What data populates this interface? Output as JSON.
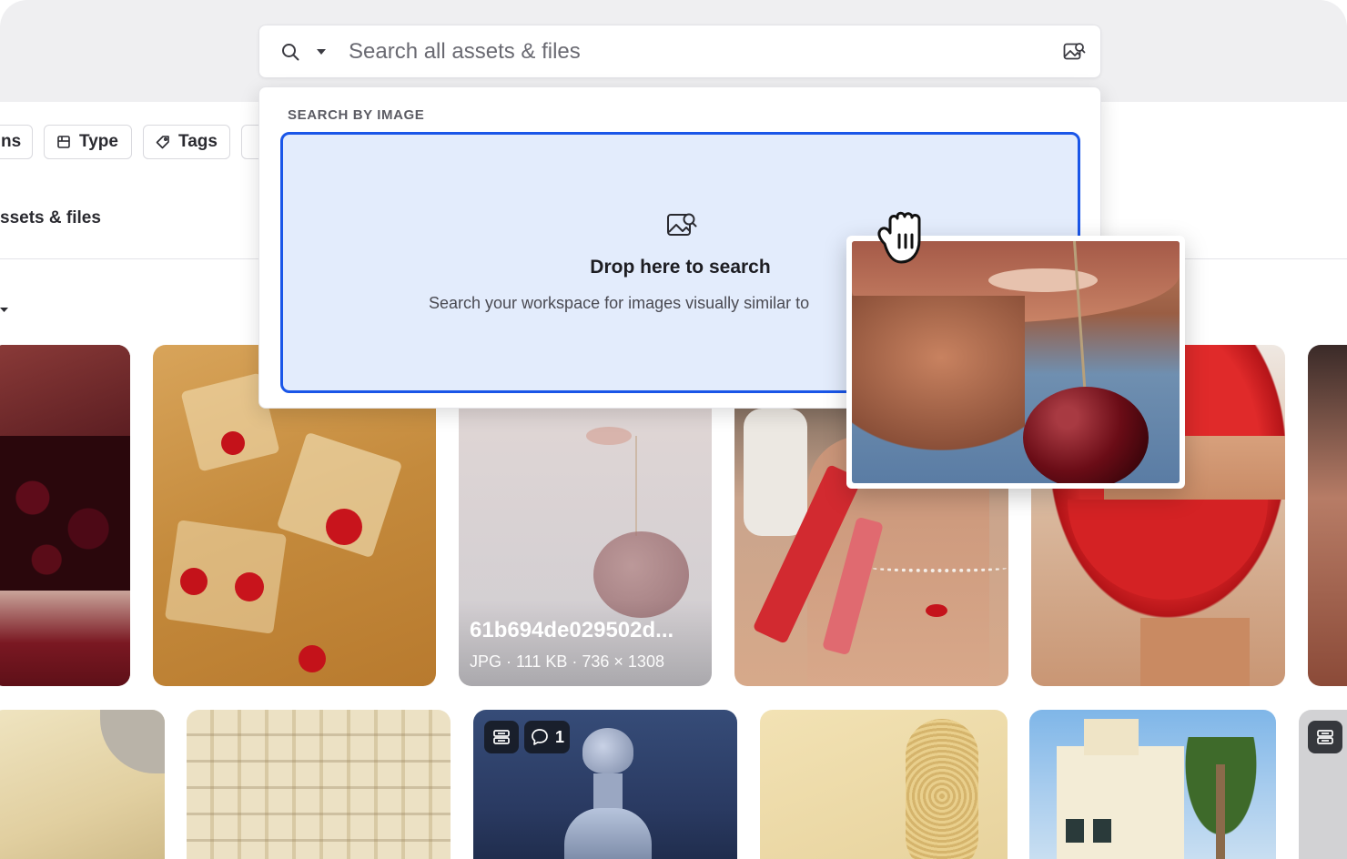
{
  "search": {
    "placeholder": "Search all assets & files",
    "icons": [
      "search-icon",
      "chevron-down-icon",
      "image-search-icon"
    ]
  },
  "filters": {
    "partial_label": "ns",
    "type_label": "Type",
    "tags_label": "Tags"
  },
  "section": {
    "title": "ssets & files"
  },
  "dropdown": {
    "section_label": "SEARCH BY IMAGE",
    "drop_title": "Drop here to search",
    "drop_subtitle": "Search your workspace for images visually similar to"
  },
  "assets": {
    "hovered_name": "61b694de029502d...",
    "hovered_info": "JPG · 111 KB · 736 × 1308",
    "comment_count": "1"
  },
  "colors": {
    "accent": "#1a56e8",
    "dropzone_bg": "#e3ecfc",
    "topbar_bg": "#efeff1"
  }
}
